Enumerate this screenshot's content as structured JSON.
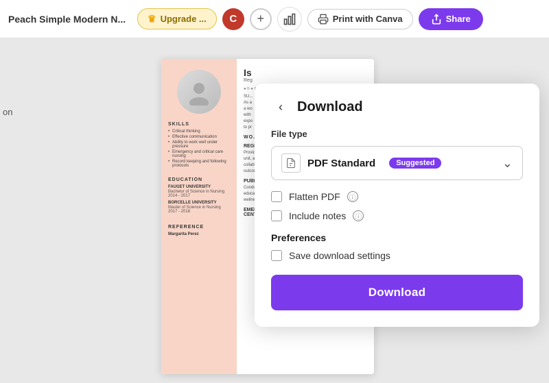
{
  "navbar": {
    "title": "Peach Simple Modern N...",
    "upgrade_label": "Upgrade ...",
    "avatar_letter": "C",
    "plus_symbol": "+",
    "print_label": "Print with Canva",
    "share_label": "Share"
  },
  "download_panel": {
    "back_icon": "‹",
    "title": "Download",
    "file_type_section_label": "File type",
    "file_type_name": "PDF Standard",
    "suggested_badge": "Suggested",
    "flatten_pdf_label": "Flatten PDF",
    "include_notes_label": "Include notes",
    "preferences_label": "Preferences",
    "save_settings_label": "Save download settings",
    "download_button_label": "Download",
    "chevron": "⌄"
  },
  "resume": {
    "name": "Is",
    "role": "Reg",
    "skills_title": "SKILLS",
    "skills": [
      "Critical thinking",
      "Effective communication",
      "Ability to work well under pressure",
      "Emergency and critical care nursing",
      "Record keeping and following protocols"
    ],
    "education_title": "EDUCATION",
    "edu_items": [
      {
        "uni": "FAUGET UNIVERSITY",
        "deg": "Bachelor of Science in Nursing",
        "years": "2014 - 2017"
      },
      {
        "uni": "BORCELLE UNIVERSITY",
        "deg": "Master of Science in Nursing",
        "years": "2017 - 2018"
      }
    ],
    "reference_title": "REFERENCE",
    "reference_name": "Margarita Perez",
    "work_title": "WO...",
    "job1_title": "REGISTERED NURSE AT BORCELLE HOSPITAL",
    "job1_desc": "Provided compassionate care to patients in the medical surgical unit, administering medications, conducting assessments, and collaborating with the healthcare team to ensure optimal patient outcomes.",
    "job2_title": "PUBLIC HEALTH NURSE AT FAUGET CLINIC",
    "job2_desc": "Conducted community health assessments, implemented health education programs, and administered vaccinations to promote wellness and prevent disease in the local.",
    "job3_title": "EMERGENCY ROOM NURSE AT DEF MEDICAL CENTER"
  },
  "edge_label": "on"
}
